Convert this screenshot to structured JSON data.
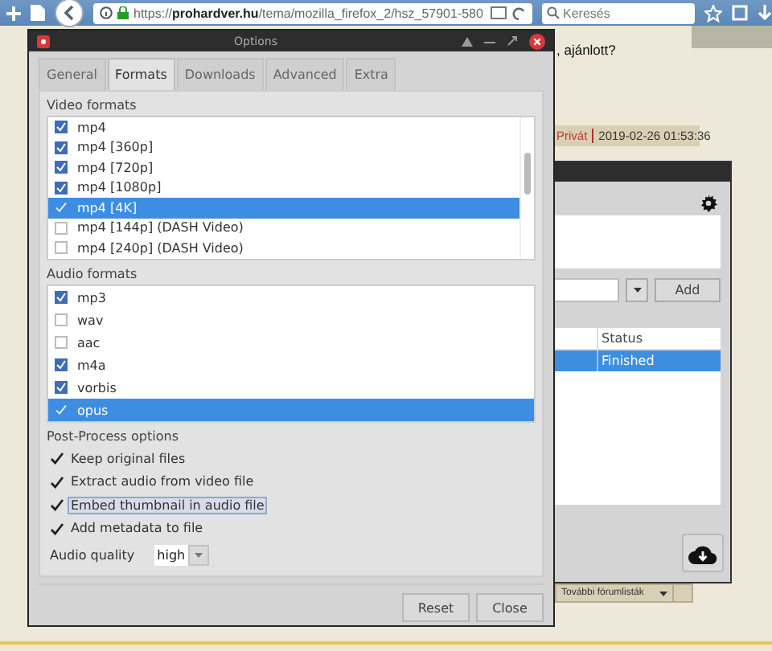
{
  "browser": {
    "url": "https://**prohardver.hu**/tema/mozilla_firefox_2/hsz_57901-580",
    "search": {
      "placeholder": "Keresés"
    }
  },
  "page": {
    "post_fragment": ", ajánlott?",
    "author": "Privát",
    "date": "2019-02-26 01:53:36",
    "forum_select": "További fórumlisták"
  },
  "background_window": {
    "add_button": "Add",
    "table": {
      "columns": [
        "Status"
      ],
      "rows": [
        {
          "status": "Finished",
          "selected": true
        }
      ]
    }
  },
  "options_window": {
    "title": "Options",
    "tabs": [
      {
        "label": "General",
        "selected": false
      },
      {
        "label": "Formats",
        "selected": true
      },
      {
        "label": "Downloads",
        "selected": false
      },
      {
        "label": "Advanced",
        "selected": false
      },
      {
        "label": "Extra",
        "selected": false
      }
    ],
    "video_formats": {
      "label": "Video formats",
      "items": [
        {
          "label": "mp4",
          "checked": true,
          "selected": false
        },
        {
          "label": "mp4 [360p]",
          "checked": true,
          "selected": false
        },
        {
          "label": "mp4 [720p]",
          "checked": true,
          "selected": false
        },
        {
          "label": "mp4 [1080p]",
          "checked": true,
          "selected": false
        },
        {
          "label": "mp4 [4K]",
          "checked": true,
          "selected": true
        },
        {
          "label": "mp4 [144p] (DASH Video)",
          "checked": false,
          "selected": false
        },
        {
          "label": "mp4 [240p] (DASH Video)",
          "checked": false,
          "selected": false
        }
      ]
    },
    "audio_formats": {
      "label": "Audio formats",
      "items": [
        {
          "label": "mp3",
          "checked": true,
          "selected": false
        },
        {
          "label": "wav",
          "checked": false,
          "selected": false
        },
        {
          "label": "aac",
          "checked": false,
          "selected": false
        },
        {
          "label": "m4a",
          "checked": true,
          "selected": false
        },
        {
          "label": "vorbis",
          "checked": true,
          "selected": false
        },
        {
          "label": "opus",
          "checked": true,
          "selected": true
        }
      ]
    },
    "post_process": {
      "label": "Post-Process options",
      "options": [
        {
          "label": "Keep original files",
          "checked": true,
          "focused": false
        },
        {
          "label": "Extract audio from video file",
          "checked": true,
          "focused": false
        },
        {
          "label": "Embed thumbnail in audio file",
          "checked": true,
          "focused": true
        },
        {
          "label": "Add metadata to file",
          "checked": true,
          "focused": false
        }
      ]
    },
    "audio_quality": {
      "label": "Audio quality",
      "value": "high"
    },
    "buttons": [
      "Reset",
      "Close"
    ]
  }
}
